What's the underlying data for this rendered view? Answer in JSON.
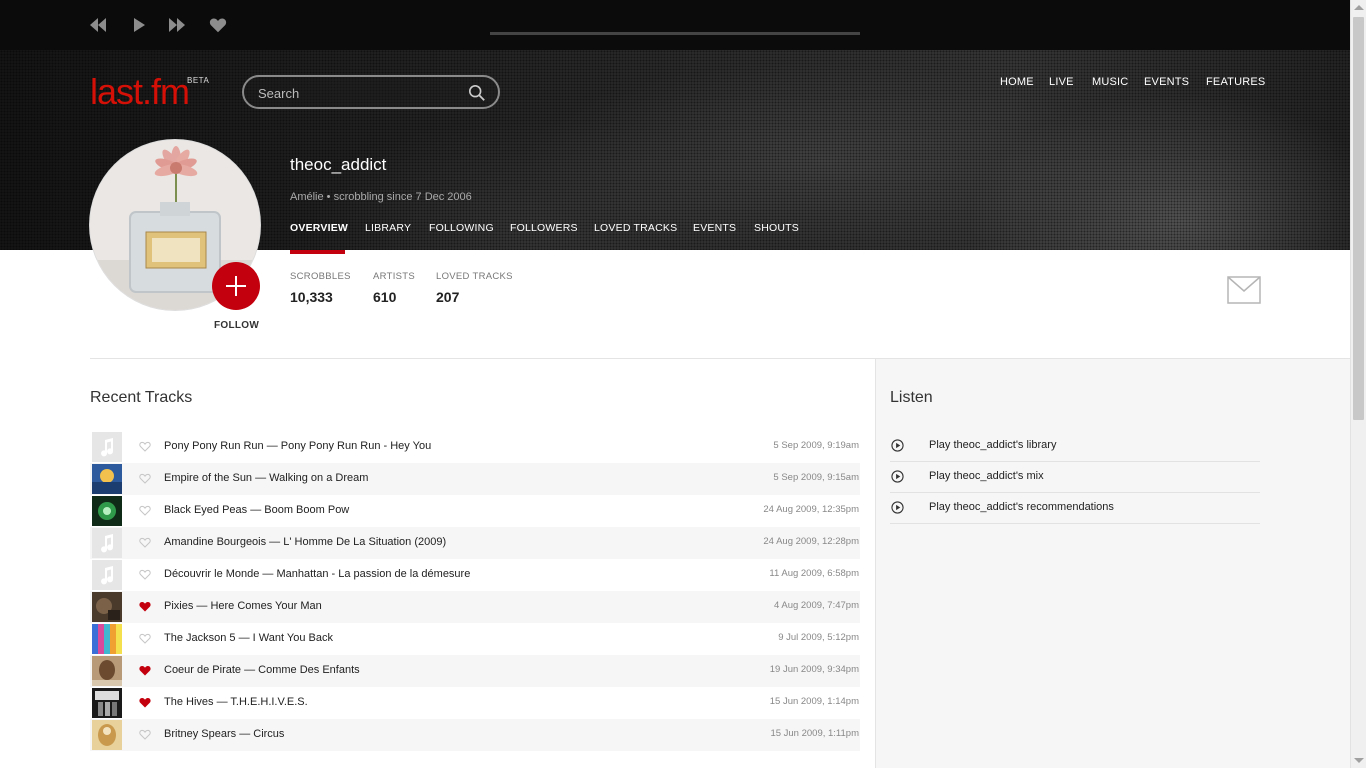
{
  "player": {
    "rewind_icon": "rewind-icon",
    "play_icon": "play-icon",
    "forward_icon": "fast-forward-icon",
    "love_icon": "heart-icon"
  },
  "header": {
    "logo": "last.fm",
    "beta": "BETA",
    "search_placeholder": "Search",
    "nav": [
      "HOME",
      "LIVE",
      "MUSIC",
      "EVENTS",
      "FEATURES"
    ]
  },
  "profile": {
    "username": "theoc_addict",
    "subinfo": "Amélie • scrobbling since 7 Dec 2006",
    "follow_label": "FOLLOW",
    "tabs": [
      "OVERVIEW",
      "LIBRARY",
      "FOLLOWING",
      "FOLLOWERS",
      "LOVED TRACKS",
      "EVENTS",
      "SHOUTS"
    ],
    "active_tab": "OVERVIEW",
    "stats": [
      {
        "label": "SCROBBLES",
        "value": "10,333"
      },
      {
        "label": "ARTISTS",
        "value": "610"
      },
      {
        "label": "LOVED TRACKS",
        "value": "207"
      }
    ]
  },
  "recent_tracks": {
    "title": "Recent Tracks",
    "items": [
      {
        "title": "Pony Pony Run Run — Pony Pony Run Run - Hey You",
        "time": "5 Sep 2009, 9:19am",
        "loved": false,
        "art": "placeholder"
      },
      {
        "title": "Empire of the Sun — Walking on a Dream",
        "time": "5 Sep 2009, 9:15am",
        "loved": false,
        "art": "blue"
      },
      {
        "title": "Black Eyed Peas — Boom Boom Pow",
        "time": "24 Aug 2009, 12:35pm",
        "loved": false,
        "art": "green"
      },
      {
        "title": "Amandine Bourgeois — L' Homme De La Situation (2009)",
        "time": "24 Aug 2009, 12:28pm",
        "loved": false,
        "art": "placeholder"
      },
      {
        "title": "Découvrir le Monde — Manhattan - La passion de la démesure",
        "time": "11 Aug 2009, 6:58pm",
        "loved": false,
        "art": "placeholder"
      },
      {
        "title": "Pixies — Here Comes Your Man",
        "time": "4 Aug 2009, 7:47pm",
        "loved": true,
        "art": "brown"
      },
      {
        "title": "The Jackson 5 — I Want You Back",
        "time": "9 Jul 2009, 5:12pm",
        "loved": false,
        "art": "rainbow"
      },
      {
        "title": "Coeur de Pirate — Comme Des Enfants",
        "time": "19 Jun 2009, 9:34pm",
        "loved": true,
        "art": "sepia"
      },
      {
        "title": "The Hives — T.H.E.H.I.V.E.S.",
        "time": "15 Jun 2009, 1:14pm",
        "loved": true,
        "art": "bw"
      },
      {
        "title": "Britney Spears — Circus",
        "time": "15 Jun 2009, 1:11pm",
        "loved": false,
        "art": "gold"
      }
    ]
  },
  "listen": {
    "title": "Listen",
    "items": [
      "Play theoc_addict's library",
      "Play theoc_addict's mix",
      "Play theoc_addict's recommendations"
    ]
  },
  "colors": {
    "accent": "#c3000d",
    "logo": "#d51007",
    "player_bg": "#0b0b0b"
  }
}
